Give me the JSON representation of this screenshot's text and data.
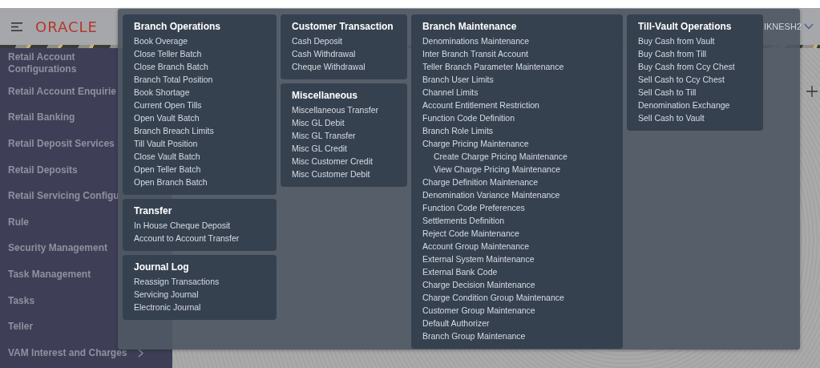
{
  "header": {
    "logo": "ORACLE",
    "user": "IKNESH2"
  },
  "sidebar": {
    "items": [
      {
        "label": "Retail Account Configurations",
        "expandable": false
      },
      {
        "label": "Retail Account Enquirie",
        "expandable": false
      },
      {
        "label": "Retail Banking",
        "expandable": false
      },
      {
        "label": "Retail Deposit Services",
        "expandable": false
      },
      {
        "label": "Retail Deposits",
        "expandable": false
      },
      {
        "label": "Retail Servicing Configu",
        "expandable": false
      },
      {
        "label": "Rule",
        "expandable": false
      },
      {
        "label": "Security Management",
        "expandable": false
      },
      {
        "label": "Task Management",
        "expandable": false
      },
      {
        "label": "Tasks",
        "expandable": false
      },
      {
        "label": "Teller",
        "expandable": false
      },
      {
        "label": "VAM Interest and Charges",
        "expandable": true
      }
    ]
  },
  "menu": {
    "columns": [
      {
        "groups": [
          {
            "title": "Branch Operations",
            "items": [
              {
                "label": "Book Overage"
              },
              {
                "label": "Close Teller Batch"
              },
              {
                "label": "Close Branch Batch"
              },
              {
                "label": "Branch Total Position"
              },
              {
                "label": "Book Shortage"
              },
              {
                "label": "Current Open Tills"
              },
              {
                "label": "Open Vault Batch"
              },
              {
                "label": "Branch Breach Limits"
              },
              {
                "label": "Till Vault Position"
              },
              {
                "label": "Close Vault Batch"
              },
              {
                "label": "Open Teller Batch"
              },
              {
                "label": "Open Branch Batch"
              }
            ]
          },
          {
            "title": "Transfer",
            "items": [
              {
                "label": "In House Cheque Deposit"
              },
              {
                "label": "Account to Account Transfer"
              }
            ]
          },
          {
            "title": "Journal Log",
            "items": [
              {
                "label": "Reassign Transactions"
              },
              {
                "label": "Servicing Journal"
              },
              {
                "label": "Electronic Journal"
              }
            ]
          }
        ]
      },
      {
        "groups": [
          {
            "title": "Customer Transaction",
            "items": [
              {
                "label": "Cash Deposit"
              },
              {
                "label": "Cash Withdrawal"
              },
              {
                "label": "Cheque Withdrawal"
              }
            ]
          },
          {
            "title": "Miscellaneous",
            "items": [
              {
                "label": "Miscellaneous Transfer"
              },
              {
                "label": "Misc GL Debit"
              },
              {
                "label": "Misc GL Transfer"
              },
              {
                "label": "Misc GL Credit"
              },
              {
                "label": "Misc Customer Credit"
              },
              {
                "label": "Misc Customer Debit"
              }
            ]
          }
        ]
      },
      {
        "groups": [
          {
            "title": "Branch Maintenance",
            "items": [
              {
                "label": "Denominations Maintenance"
              },
              {
                "label": "Inter Branch Transit Account"
              },
              {
                "label": "Teller Branch Parameter Maintenance"
              },
              {
                "label": "Branch User Limits"
              },
              {
                "label": "Channel Limits"
              },
              {
                "label": "Account Entitlement Restriction"
              },
              {
                "label": "Function Code Definition"
              },
              {
                "label": "Branch Role Limits"
              },
              {
                "label": "Charge Pricing Maintenance",
                "children": [
                  {
                    "label": "Create Charge Pricing Maintenance"
                  },
                  {
                    "label": "View Charge Pricing Maintenance"
                  }
                ]
              },
              {
                "label": "Charge Definition Maintenance"
              },
              {
                "label": "Denomination Variance Maintenance"
              },
              {
                "label": "Function Code Preferences"
              },
              {
                "label": "Settlements Definition"
              },
              {
                "label": "Reject Code Maintenance"
              },
              {
                "label": "Account Group Maintenance"
              },
              {
                "label": "External System Maintenance"
              },
              {
                "label": "External Bank Code"
              },
              {
                "label": "Charge Decision Maintenance"
              },
              {
                "label": "Charge Condition Group Maintenance"
              },
              {
                "label": "Customer Group Maintenance"
              },
              {
                "label": "Default Authorizer"
              },
              {
                "label": "Branch Group Maintenance"
              }
            ]
          }
        ]
      },
      {
        "groups": [
          {
            "title": "Till-Vault Operations",
            "items": [
              {
                "label": "Buy Cash from Vault"
              },
              {
                "label": "Buy Cash from Till"
              },
              {
                "label": "Buy Cash from Ccy Chest"
              },
              {
                "label": "Sell Cash to Ccy Chest"
              },
              {
                "label": "Sell Cash to Till"
              },
              {
                "label": "Denomination Exchange"
              },
              {
                "label": "Sell Cash to Vault"
              }
            ]
          }
        ]
      }
    ]
  }
}
